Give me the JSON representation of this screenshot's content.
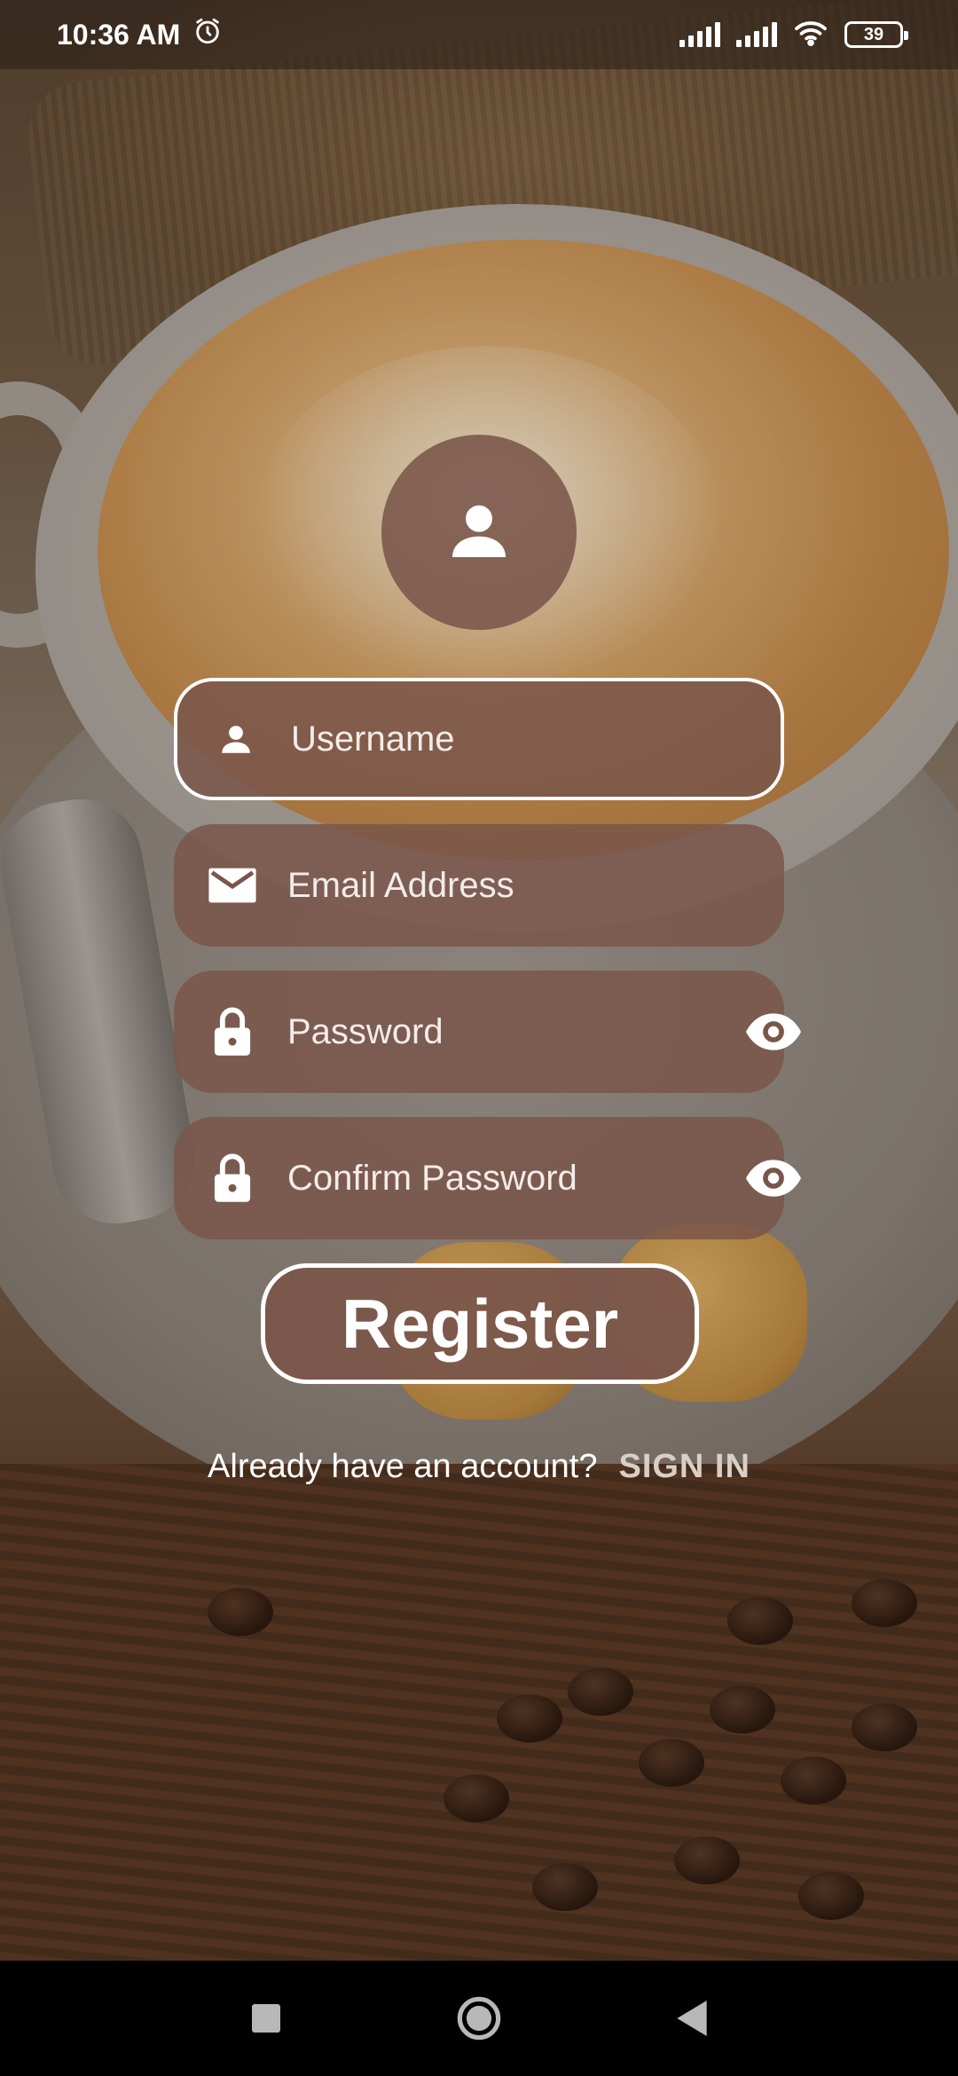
{
  "status_bar": {
    "time": "10:36 AM",
    "battery": "39"
  },
  "form": {
    "username_placeholder": "Username",
    "email_placeholder": "Email Address",
    "password_placeholder": "Password",
    "confirm_password_placeholder": "Confirm Password",
    "register_label": "Register"
  },
  "footer": {
    "question": "Already have an account?",
    "signin_label": "SIGN IN"
  },
  "icons": {
    "avatar": "person-icon",
    "username": "person-icon",
    "email": "mail-icon",
    "password": "lock-icon",
    "visibility": "eye-icon"
  },
  "colors": {
    "field_background": "#7A564A",
    "text": "#FFFFFF",
    "link": "#D9CFC9"
  }
}
